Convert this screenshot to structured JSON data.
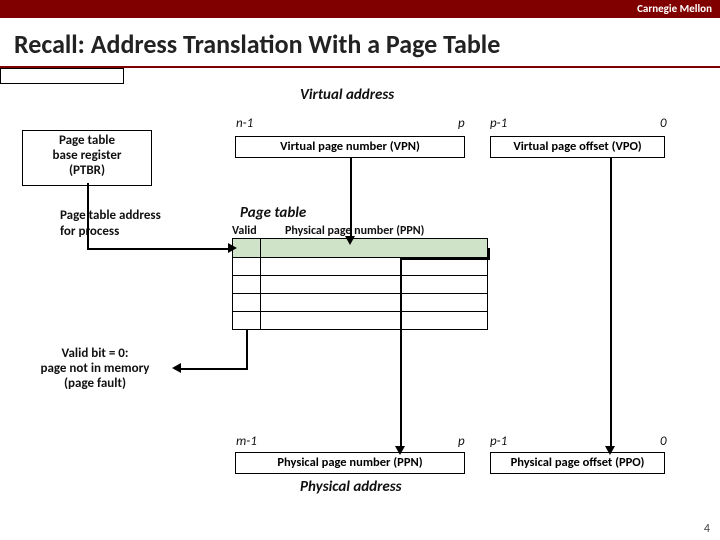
{
  "brand": "Carnegie Mellon",
  "title": "Recall: Address Translation With a Page Table",
  "va_label": "Virtual address",
  "pa_label": "Physical address",
  "ticks": {
    "n1": "n-1",
    "p": "p",
    "p1": "p-1",
    "zero": "0",
    "m1": "m-1"
  },
  "ptbr": {
    "l1": "Page table",
    "l2": "base register",
    "l3": "(PTBR)"
  },
  "pta": {
    "l1": "Page table address",
    "l2": "for process"
  },
  "fault": {
    "l1": "Valid bit = 0:",
    "l2": "page not in memory",
    "l3": "(page fault)"
  },
  "vpn": "Virtual page number (VPN)",
  "vpo": "Virtual page offset (VPO)",
  "ppn": "Physical page number (PPN)",
  "ppo": "Physical page offset (PPO)",
  "pt_title": "Page table",
  "pt_head_valid": "Valid",
  "pt_head_ppn": "Physical page number (PPN)",
  "pagenum": "4"
}
